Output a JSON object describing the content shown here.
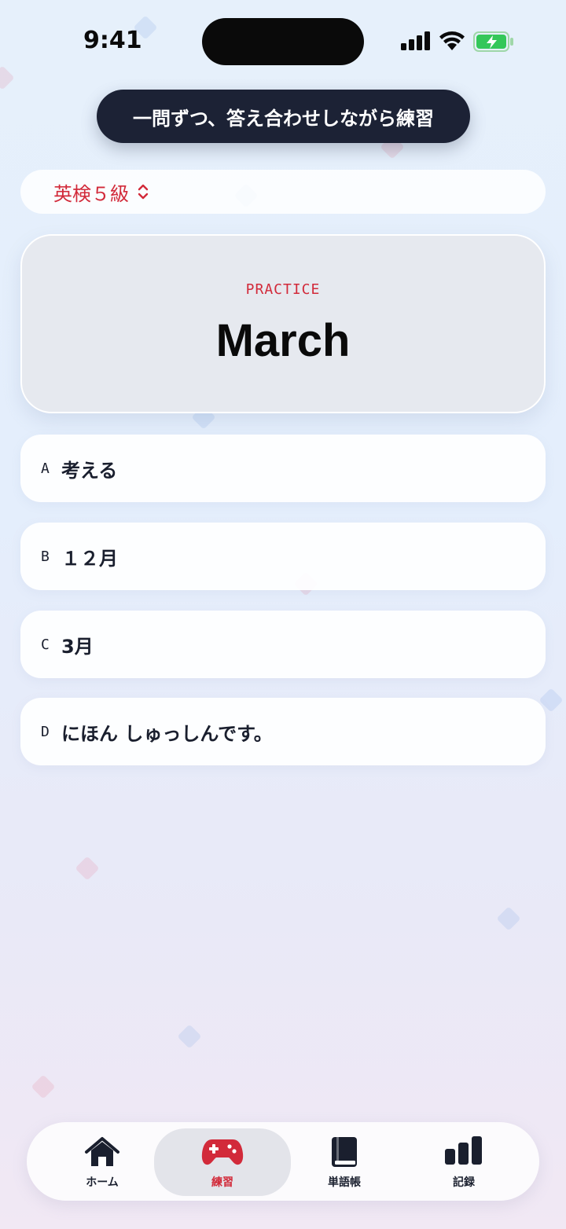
{
  "status": {
    "time": "9:41"
  },
  "toast": {
    "text": "一問ずつ、答え合わせしながら練習"
  },
  "level_selector": {
    "label": "英検５級"
  },
  "card": {
    "kicker": "PRACTICE",
    "word": "March"
  },
  "options": [
    {
      "letter": "A",
      "text": "考える"
    },
    {
      "letter": "B",
      "text": "１２月"
    },
    {
      "letter": "C",
      "text": "3月"
    },
    {
      "letter": "D",
      "text": "にほん しゅっしんです。"
    }
  ],
  "tabs": [
    {
      "label": "ホーム",
      "icon": "home-icon"
    },
    {
      "label": "練習",
      "icon": "gamepad-icon"
    },
    {
      "label": "単語帳",
      "icon": "book-icon"
    },
    {
      "label": "記録",
      "icon": "bar-chart-icon"
    }
  ],
  "colors": {
    "accent": "#d22a3a",
    "toast_bg": "#1c2235",
    "text": "#1a1f2e"
  }
}
